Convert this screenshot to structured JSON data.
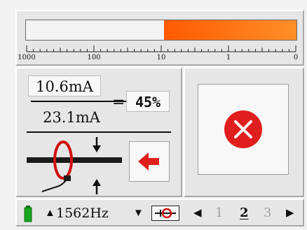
{
  "meter": {
    "level_fraction": 0.49,
    "scale_labels": [
      "1000",
      "100",
      "10",
      "1",
      "0"
    ],
    "fill_colors": [
      "#ff5a00",
      "#ff8f28"
    ]
  },
  "reading": {
    "measured": "10.6mA",
    "reference": "23.1mA",
    "equals": "=",
    "percent": "45%"
  },
  "icons": {
    "clamp": "clamp-probe-icon",
    "direction": "arrow-left-icon",
    "status": "error-x-icon"
  },
  "colors": {
    "accent_red": "#e01e1e",
    "clamp_red": "#d01010",
    "battery_green": "#19a51c"
  },
  "footer": {
    "frequency": "1562Hz",
    "up": "▲",
    "down": "▼",
    "prev": "◀",
    "next": "▶",
    "pages": [
      "1",
      "2",
      "3"
    ],
    "active_page": "2"
  }
}
